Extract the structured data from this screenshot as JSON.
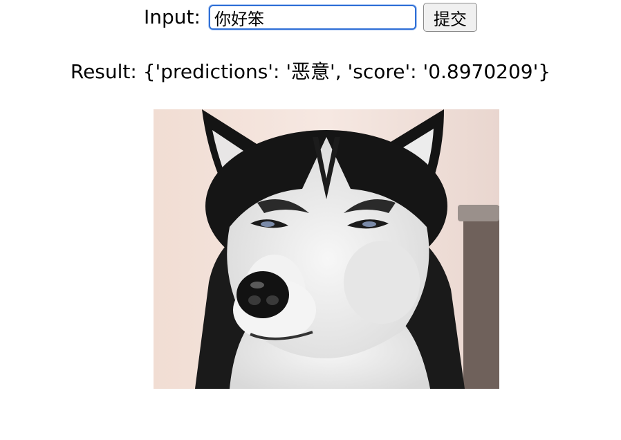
{
  "form": {
    "input_label": "Input:",
    "input_value": "你好笨",
    "submit_label": "提交",
    "colors": {
      "input_border": "#2f6fd6"
    }
  },
  "result": {
    "text": "Result: {'predictions': '恶意', 'score': '0.8970209'}"
  },
  "image": {
    "subject": "husky-dog-photo"
  }
}
